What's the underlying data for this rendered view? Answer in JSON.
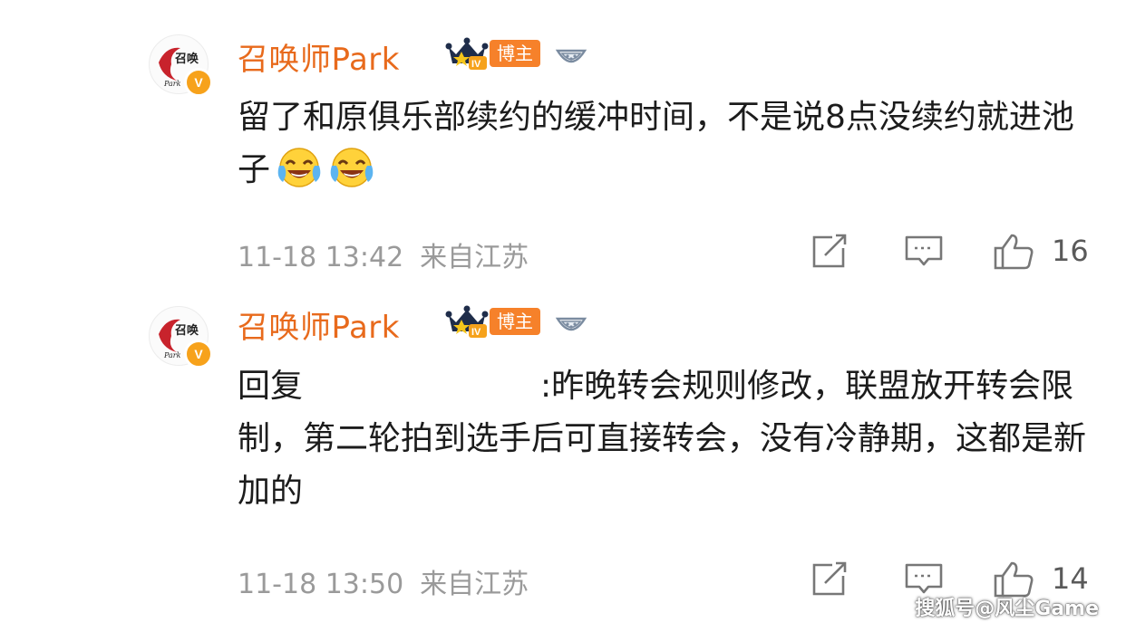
{
  "comments": [
    {
      "username": "召唤师Park",
      "avatar_text": "召唤",
      "avatar_sub": "Park",
      "verified_badge": "V",
      "level_badge": "IV",
      "tag": "博主",
      "text": "留了和原俱乐部续约的缓冲时间，不是说8点没续约就进池子",
      "emoji": [
        "laugh-cry-emoji",
        "laugh-cry-emoji"
      ],
      "time": "11-18 13:42",
      "location": "来自江苏",
      "likes": "16"
    },
    {
      "username": "召唤师Park",
      "avatar_text": "召唤",
      "avatar_sub": "Park",
      "verified_badge": "V",
      "level_badge": "IV",
      "tag": "博主",
      "reply_prefix": "回复",
      "text": ":昨晚转会规则修改，联盟放开转会限制，第二轮拍到选手后可直接转会，没有冷静期，这都是新加的",
      "time": "11-18 13:50",
      "location": "来自江苏",
      "likes": "14"
    }
  ],
  "watermark": "搜狐号@风尘Game",
  "colors": {
    "username": "#e86a1c",
    "tag_bg": "#f6812a",
    "verified": "#f7a21b",
    "meta": "#9a9a9a"
  }
}
